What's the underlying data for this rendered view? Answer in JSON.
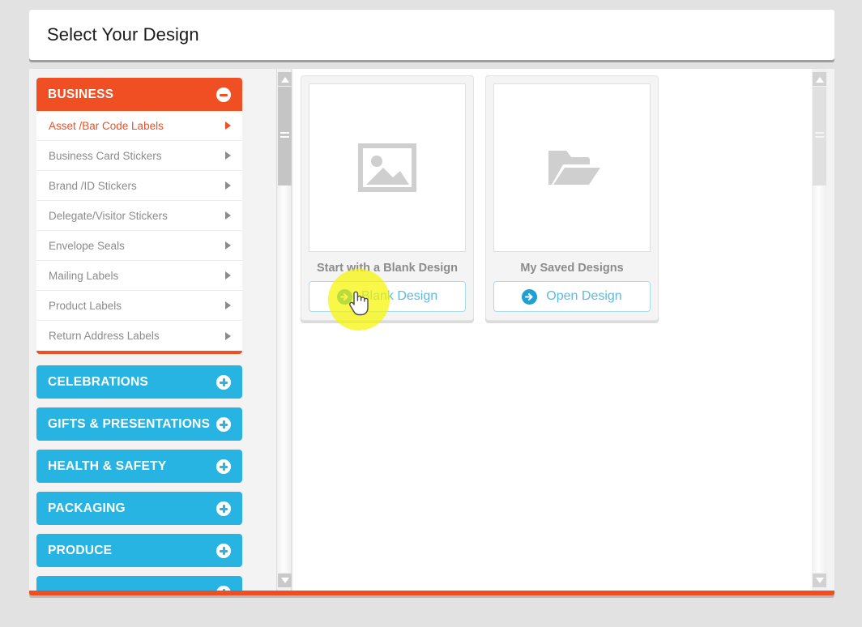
{
  "header": {
    "title": "Select Your Design"
  },
  "sidebar": {
    "categories": [
      {
        "label": "BUSINESS",
        "state": "open",
        "toggle_icon": "minus-circle-icon",
        "items": [
          {
            "label": "Asset /Bar Code Labels",
            "active": true
          },
          {
            "label": "Business Card Stickers",
            "active": false
          },
          {
            "label": "Brand /ID Stickers",
            "active": false
          },
          {
            "label": "Delegate/Visitor Stickers",
            "active": false
          },
          {
            "label": "Envelope Seals",
            "active": false
          },
          {
            "label": "Mailing Labels",
            "active": false
          },
          {
            "label": "Product Labels",
            "active": false
          },
          {
            "label": "Return Address Labels",
            "active": false
          }
        ]
      },
      {
        "label": "CELEBRATIONS",
        "state": "closed",
        "toggle_icon": "plus-circle-icon",
        "items": []
      },
      {
        "label": "GIFTS & PRESENTATIONS",
        "state": "closed",
        "toggle_icon": "plus-circle-icon",
        "items": []
      },
      {
        "label": "HEALTH & SAFETY",
        "state": "closed",
        "toggle_icon": "plus-circle-icon",
        "items": []
      },
      {
        "label": "PACKAGING",
        "state": "closed",
        "toggle_icon": "plus-circle-icon",
        "items": []
      },
      {
        "label": "PRODUCE",
        "state": "closed",
        "toggle_icon": "plus-circle-icon",
        "items": []
      },
      {
        "label": "",
        "state": "closed",
        "toggle_icon": "plus-circle-icon",
        "items": []
      }
    ]
  },
  "main": {
    "cards": [
      {
        "title": "Start with a Blank Design",
        "thumb_icon": "image-placeholder-icon",
        "button_label": "Blank Design",
        "button_icon": "arrow-right-circle-icon"
      },
      {
        "title": "My Saved Designs",
        "thumb_icon": "folder-open-icon",
        "button_label": "Open Design",
        "button_icon": "arrow-right-circle-icon"
      }
    ]
  },
  "scrollbars": {
    "left": {
      "up_icon": "triangle-up-icon",
      "down_icon": "triangle-down-icon"
    },
    "right": {
      "up_icon": "triangle-up-icon",
      "down_icon": "triangle-down-icon"
    }
  },
  "cursor": {
    "icon": "pointing-hand-cursor",
    "highlight": "click-highlight"
  },
  "colors": {
    "orange": "#f04e23",
    "blue": "#27b4e2",
    "link_blue": "#5bbcdf",
    "highlight_yellow": "#f6f400",
    "page_bg": "#e2e2e2"
  }
}
